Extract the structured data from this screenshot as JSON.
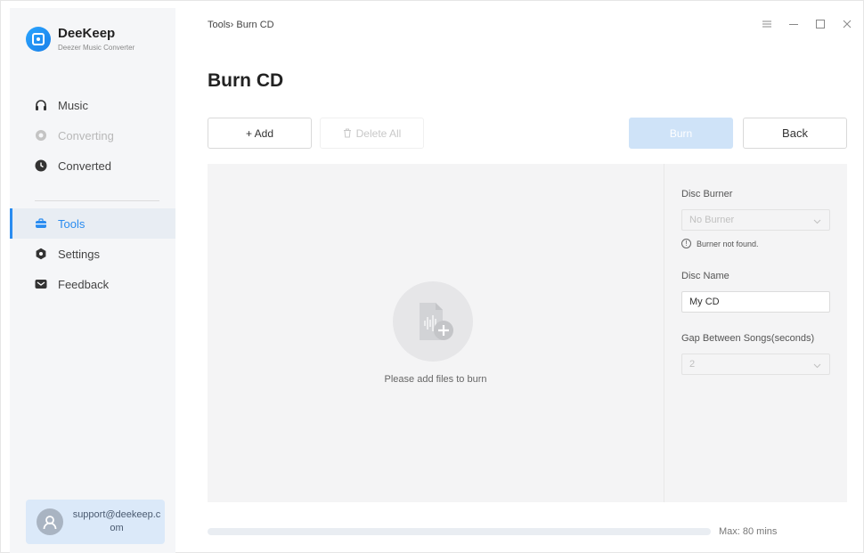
{
  "app": {
    "name": "DeeKeep",
    "subtitle": "Deezer Music Converter"
  },
  "sidebar": {
    "items": [
      {
        "label": "Music",
        "icon": "headphones-icon",
        "state": "normal"
      },
      {
        "label": "Converting",
        "icon": "converting-icon",
        "state": "disabled"
      },
      {
        "label": "Converted",
        "icon": "clock-icon",
        "state": "normal"
      },
      {
        "label": "Tools",
        "icon": "toolbox-icon",
        "state": "active"
      },
      {
        "label": "Settings",
        "icon": "gear-icon",
        "state": "normal"
      },
      {
        "label": "Feedback",
        "icon": "mail-icon",
        "state": "normal"
      }
    ],
    "support_email": "support@deekeep.com"
  },
  "header": {
    "breadcrumb": "Tools› Burn CD",
    "title": "Burn CD"
  },
  "toolbar": {
    "add_label": "+ Add",
    "delete_all_label": "Delete All",
    "burn_label": "Burn",
    "back_label": "Back"
  },
  "drop_area": {
    "message": "Please add files to burn"
  },
  "settings": {
    "disc_burner_label": "Disc Burner",
    "disc_burner_value": "No Burner",
    "burner_warning": "Burner not found.",
    "disc_name_label": "Disc Name",
    "disc_name_value": "My CD",
    "gap_label": "Gap Between Songs(seconds)",
    "gap_value": "2"
  },
  "capacity": {
    "used_fraction": 0,
    "max_label": "Max: 80 mins"
  },
  "colors": {
    "accent": "#2a8cf0",
    "burn_disabled": "#cfe3f8",
    "support_bg": "#dbe9f9"
  }
}
